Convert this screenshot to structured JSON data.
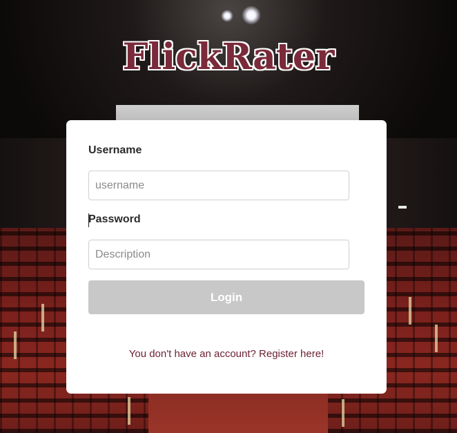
{
  "app": {
    "logo_text": "FlickRater"
  },
  "login_form": {
    "username_label": "Username",
    "username_placeholder": "username",
    "username_value": "",
    "password_label": "Password",
    "password_placeholder": "Description",
    "password_value": "",
    "login_button_label": "Login",
    "register_link_text": "You don't have an account? Register here!"
  },
  "colors": {
    "logo": "#7a2a3a",
    "login_button_disabled": "#c8c8c8",
    "register_link": "#6b2234"
  }
}
